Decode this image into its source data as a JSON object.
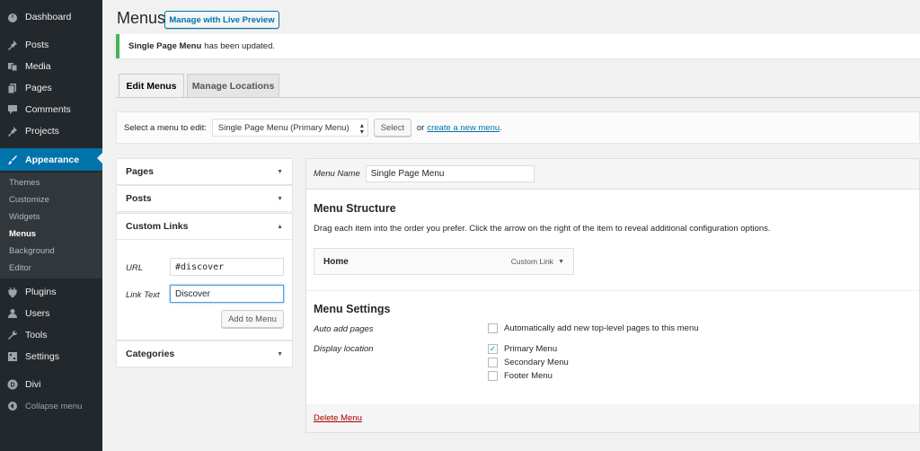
{
  "sidebar": {
    "items": [
      {
        "name": "dashboard",
        "label": "Dashboard",
        "icon": "dashboard-icon"
      },
      {
        "name": "posts",
        "label": "Posts",
        "icon": "pin-icon"
      },
      {
        "name": "media",
        "label": "Media",
        "icon": "media-icon"
      },
      {
        "name": "pages",
        "label": "Pages",
        "icon": "pages-icon"
      },
      {
        "name": "comments",
        "label": "Comments",
        "icon": "comment-icon"
      },
      {
        "name": "projects",
        "label": "Projects",
        "icon": "pin-icon"
      },
      {
        "name": "appearance",
        "label": "Appearance",
        "icon": "paintbrush-icon"
      },
      {
        "name": "plugins",
        "label": "Plugins",
        "icon": "plug-icon"
      },
      {
        "name": "users",
        "label": "Users",
        "icon": "user-icon"
      },
      {
        "name": "tools",
        "label": "Tools",
        "icon": "wrench-icon"
      },
      {
        "name": "settings",
        "label": "Settings",
        "icon": "settings-icon"
      },
      {
        "name": "divi",
        "label": "Divi",
        "icon": "divi-icon"
      }
    ],
    "submenu": [
      "Themes",
      "Customize",
      "Widgets",
      "Menus",
      "Background",
      "Editor"
    ],
    "collapse_label": "Collapse menu",
    "accent_color": "#0073aa"
  },
  "header": {
    "title": "Menus",
    "live_preview_label": "Manage with Live Preview"
  },
  "notice": {
    "menu_name": "Single Page Menu",
    "text": "has been updated."
  },
  "tabs": [
    "Edit Menus",
    "Manage Locations"
  ],
  "select_bar": {
    "label": "Select a menu to edit:",
    "selected": "Single Page Menu (Primary Menu)",
    "select_button": "Select",
    "or_text": "or",
    "create_link": "create a new menu",
    "period": "."
  },
  "left_panel": {
    "pages_label": "Pages",
    "posts_label": "Posts",
    "custom_links_label": "Custom Links",
    "url_label": "URL",
    "url_value": "#discover",
    "link_text_label": "Link Text",
    "link_text_value": "Discover",
    "add_button": "Add to Menu",
    "categories_label": "Categories"
  },
  "right_panel": {
    "menu_name_label": "Menu Name",
    "menu_name_value": "Single Page Menu",
    "structure_title": "Menu Structure",
    "structure_desc": "Drag each item into the order you prefer. Click the arrow on the right of the item to reveal additional configuration options.",
    "menu_item": {
      "title": "Home",
      "type": "Custom Link"
    },
    "settings_title": "Menu Settings",
    "auto_add_label": "Auto add pages",
    "auto_add_text": "Automatically add new top-level pages to this menu",
    "auto_add_checked": false,
    "display_location_label": "Display location",
    "locations": [
      {
        "label": "Primary Menu",
        "checked": true
      },
      {
        "label": "Secondary Menu",
        "checked": false
      },
      {
        "label": "Footer Menu",
        "checked": false
      }
    ],
    "delete_link": "Delete Menu"
  }
}
